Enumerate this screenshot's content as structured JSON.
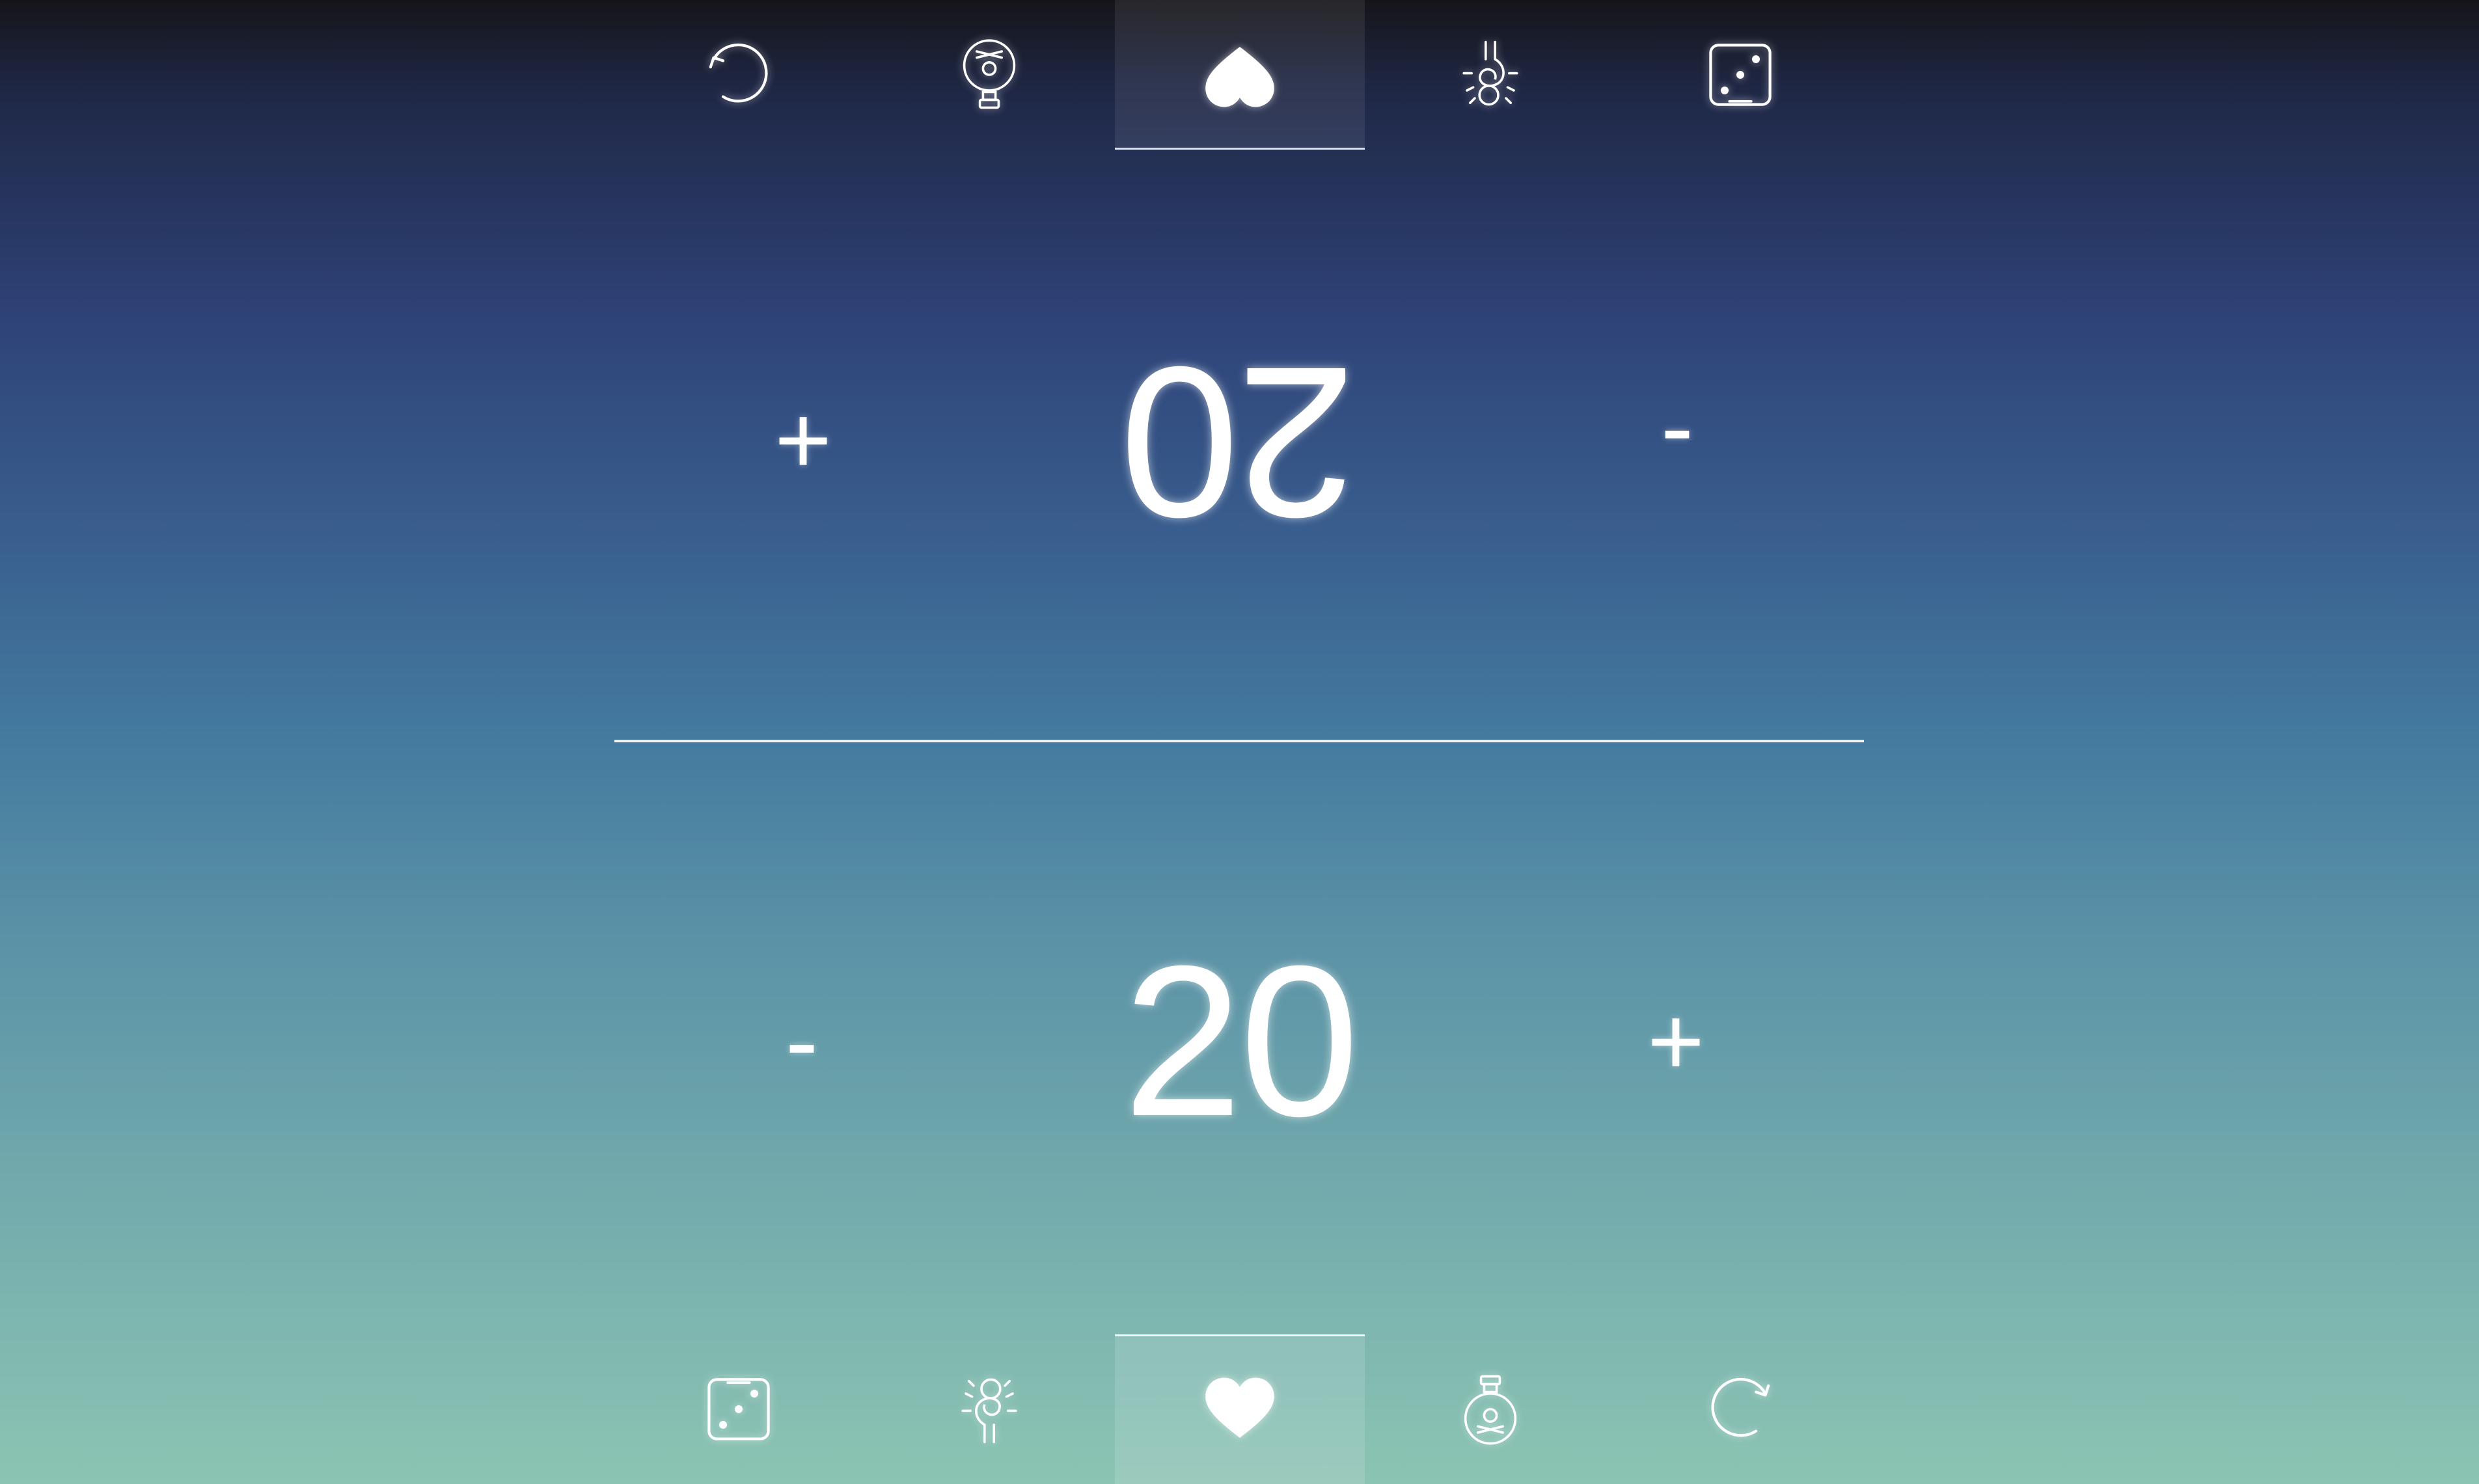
{
  "toolbars": {
    "top": {
      "items": [
        {
          "icon": "reset-icon"
        },
        {
          "icon": "poison-icon"
        },
        {
          "icon": "heart-icon",
          "active": true
        },
        {
          "icon": "commander-damage-icon"
        },
        {
          "icon": "dice-icon"
        }
      ]
    },
    "bottom": {
      "items": [
        {
          "icon": "dice-icon"
        },
        {
          "icon": "commander-damage-icon"
        },
        {
          "icon": "heart-icon",
          "active": true
        },
        {
          "icon": "poison-icon"
        },
        {
          "icon": "reset-icon"
        }
      ]
    }
  },
  "players": {
    "opponent": {
      "life": "20",
      "increment_label": "+",
      "decrement_label": "-"
    },
    "self": {
      "life": "20",
      "increment_label": "+",
      "decrement_label": "-"
    }
  },
  "colors": {
    "gradient_top": "#151519",
    "gradient_mid": "#447b9f",
    "gradient_bottom": "#8cc4b3",
    "foreground": "#ffffff"
  }
}
